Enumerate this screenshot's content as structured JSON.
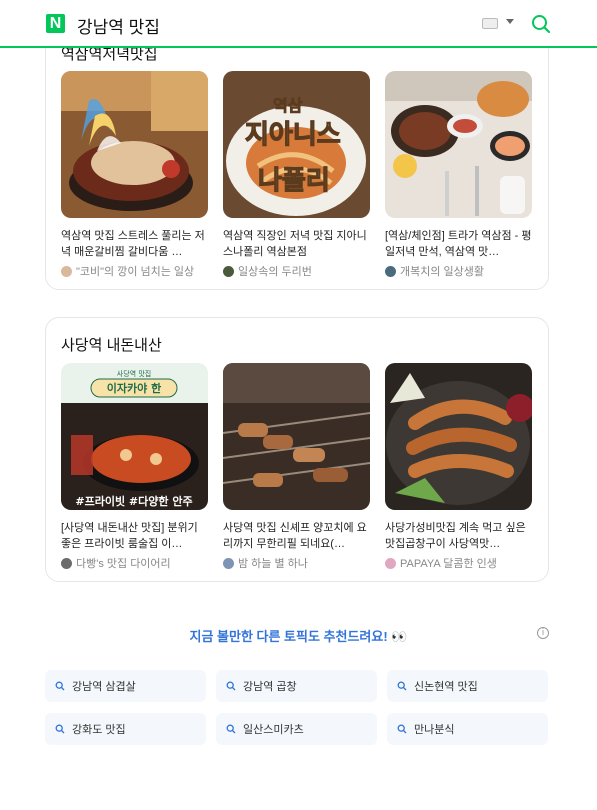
{
  "header": {
    "logo": "N",
    "query": "강남역 맛집",
    "icons": {
      "keyboard": "keyboard-icon",
      "caret": "chevron-down-icon",
      "search": "search-icon"
    },
    "accent": "#03c75a"
  },
  "cards": [
    {
      "title": "역삼역저녁맛집",
      "items": [
        {
          "title": "역삼역 맛집 스트레스 풀리는 저녁 매운갈비찜 갈비다움 …",
          "author": "\"코비\"의 깡이 넘치는 일상"
        },
        {
          "title": "역삼역 직장인 저녁 맛집 지아니스나폴리 역삼본점",
          "author": "일상속의 두리번"
        },
        {
          "title": "[역삼/체인점] 트라가 역삼점 - 평일저녁 만석, 역삼역 맛…",
          "author": "개복치의 일상생활"
        }
      ]
    },
    {
      "title": "사당역 내돈내산",
      "items": [
        {
          "title": "[사당역 내돈내산 맛집] 분위기 좋은 프라이빗 룸술집 이…",
          "author": "다빵's 맛집 다이어리"
        },
        {
          "title": "사당역 맛집 신셰프 양꼬치에 요리까지 무한리필 되네요(…",
          "author": "밤 하늘 별 하나"
        },
        {
          "title": "사당가성비맛집 계속 먹고 싶은 맛집곱창구이 사당역맛…",
          "author": "PAPAYA 달콤한 인생"
        }
      ]
    }
  ],
  "thumb_text": {
    "giannis_top": "역삼",
    "giannis_mid": "지아니스",
    "giannis_bot": "나폴리",
    "izakaya_sub": "사당역 맛집",
    "izakaya_name": "이자카야 한",
    "izakaya_tags": "#프라이빗 #다양한 안주"
  },
  "recommend": {
    "text": "지금 볼만한 다른 토픽도 추천드려요! 👀",
    "info": "i",
    "color": "#3374d9"
  },
  "topics": [
    "강남역 삼겹살",
    "강남역 곱창",
    "신논현역 맛집",
    "강화도 맛집",
    "일산스미카츠",
    "만나분식"
  ]
}
